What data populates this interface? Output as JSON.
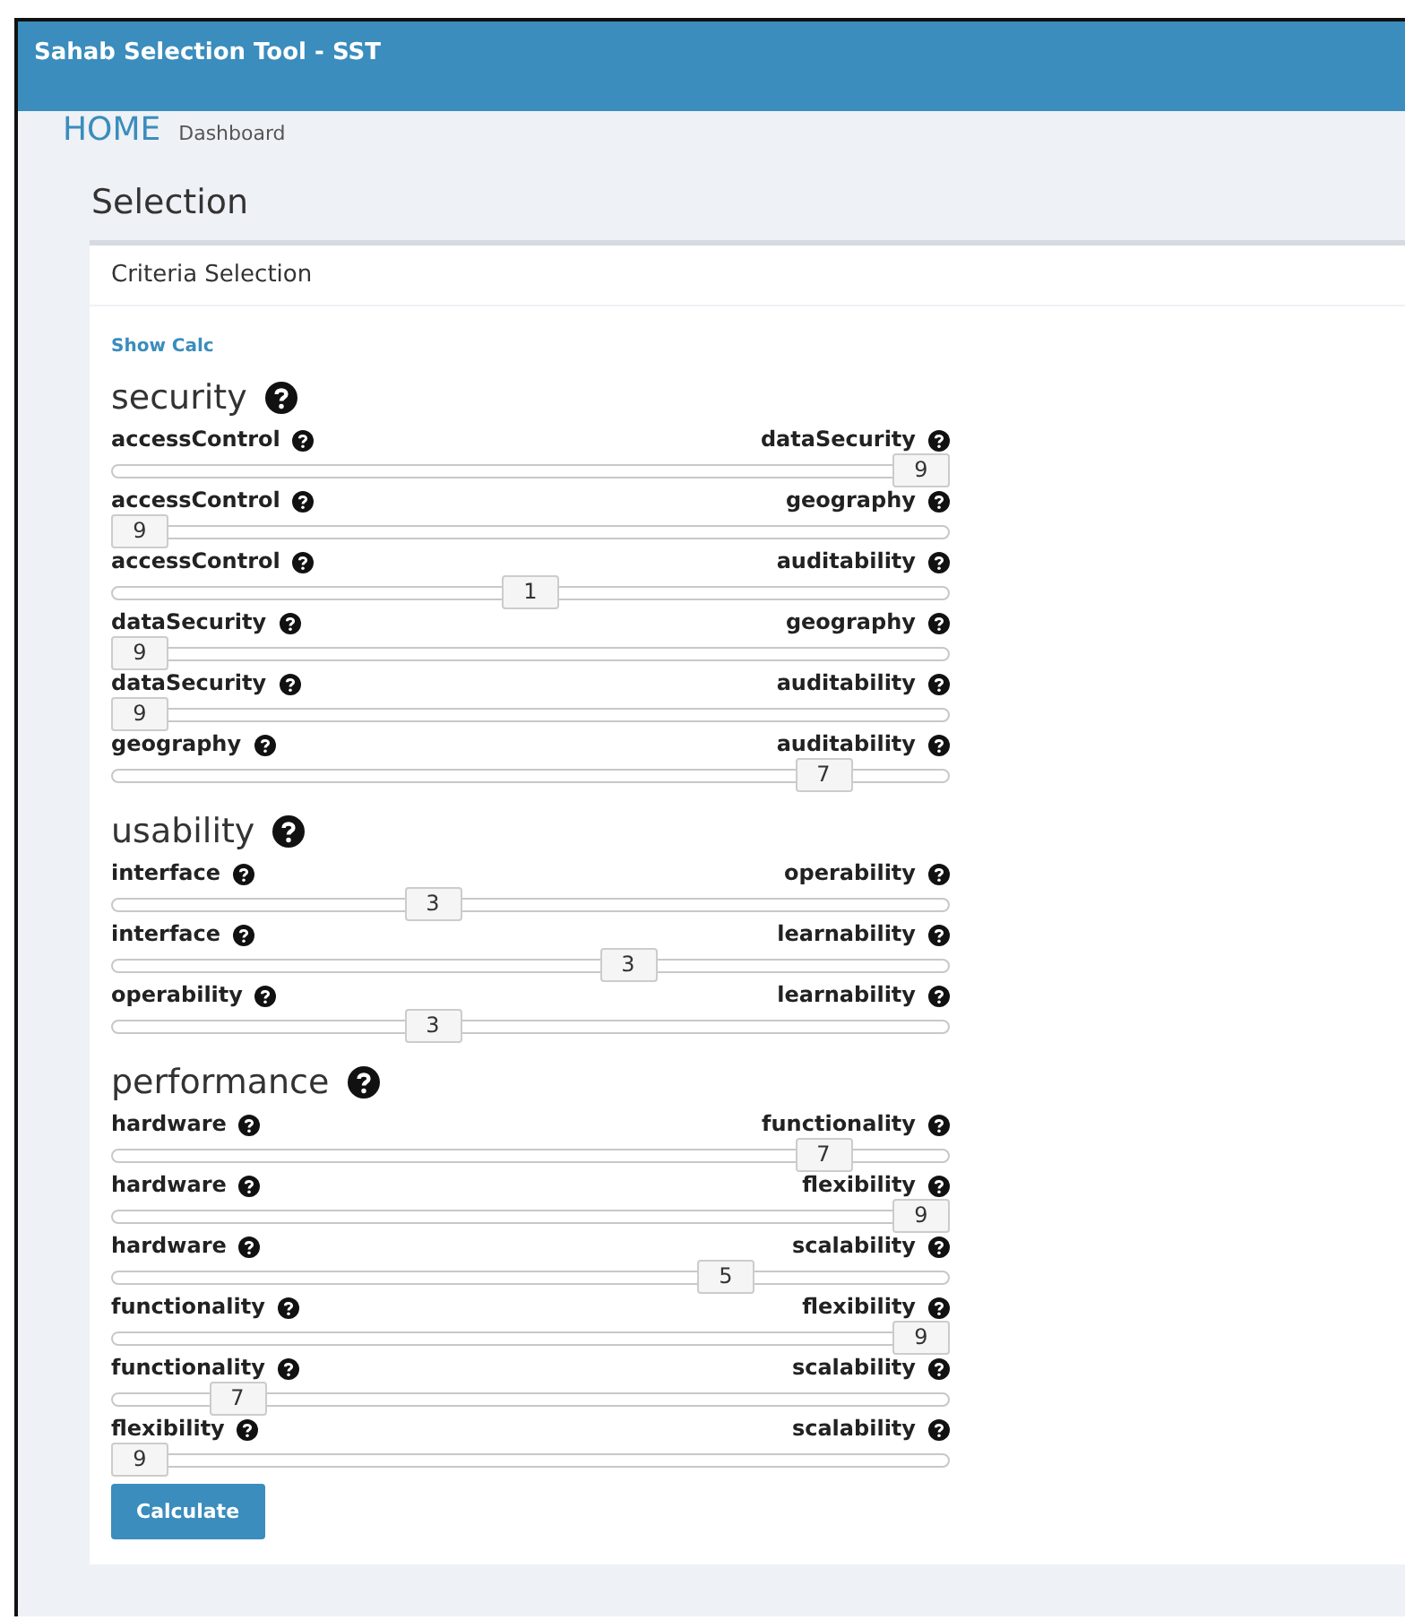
{
  "header": {
    "title": "Sahab Selection Tool - SST"
  },
  "breadcrumb": {
    "home": "HOME",
    "page": "Dashboard"
  },
  "page_title": "Selection",
  "card": {
    "title": "Criteria Selection",
    "show_calc_link": "Show Calc",
    "groups": [
      {
        "name": "security",
        "comparisons": [
          {
            "left": "accessControl",
            "right": "dataSecurity",
            "value": "9",
            "level": 1
          },
          {
            "left": "accessControl",
            "right": "geography",
            "value": "9",
            "level": 0
          },
          {
            "left": "accessControl",
            "right": "auditability",
            "value": "1",
            "level": 0.5
          },
          {
            "left": "dataSecurity",
            "right": "geography",
            "value": "9",
            "level": 0
          },
          {
            "left": "dataSecurity",
            "right": "auditability",
            "value": "9",
            "level": 0
          },
          {
            "left": "geography",
            "right": "auditability",
            "value": "7",
            "level": 0.875
          }
        ]
      },
      {
        "name": "usability",
        "comparisons": [
          {
            "left": "interface",
            "right": "operability",
            "value": "3",
            "level": 0.375
          },
          {
            "left": "interface",
            "right": "learnability",
            "value": "3",
            "level": 0.625
          },
          {
            "left": "operability",
            "right": "learnability",
            "value": "3",
            "level": 0.375
          }
        ]
      },
      {
        "name": "performance",
        "comparisons": [
          {
            "left": "hardware",
            "right": "functionality",
            "value": "7",
            "level": 0.875
          },
          {
            "left": "hardware",
            "right": "flexibility",
            "value": "9",
            "level": 1
          },
          {
            "left": "hardware",
            "right": "scalability",
            "value": "5",
            "level": 0.75
          },
          {
            "left": "functionality",
            "right": "flexibility",
            "value": "9",
            "level": 1
          },
          {
            "left": "functionality",
            "right": "scalability",
            "value": "7",
            "level": 0.125
          },
          {
            "left": "flexibility",
            "right": "scalability",
            "value": "9",
            "level": 0
          }
        ]
      }
    ],
    "button": "Calculate"
  }
}
